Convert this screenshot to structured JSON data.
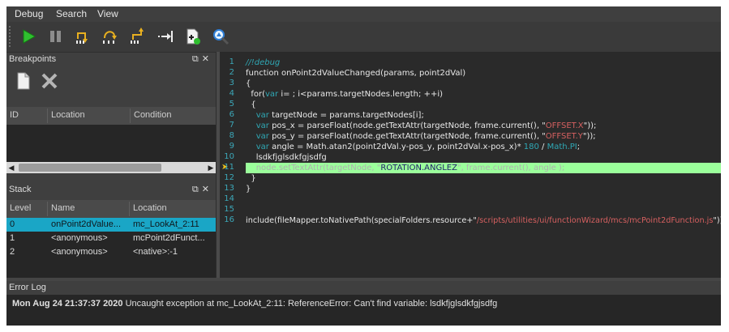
{
  "menu": [
    "Debug",
    "Search",
    "View"
  ],
  "toolbar": {
    "buttons": [
      "run-icon",
      "pause-icon",
      "step-into-icon",
      "step-over-icon",
      "step-out-icon",
      "run-to-cursor-icon",
      "add-watch-icon",
      "inspect-icon"
    ]
  },
  "breakpoints": {
    "title": "Breakpoints",
    "columns": [
      "ID",
      "Location",
      "Condition"
    ],
    "rows": []
  },
  "stack": {
    "title": "Stack",
    "columns": [
      "Level",
      "Name",
      "Location"
    ],
    "rows": [
      {
        "level": "0",
        "name": "onPoint2dValue...",
        "location": "mc_LookAt_2:11",
        "selected": true
      },
      {
        "level": "1",
        "name": "<anonymous>",
        "location": "mcPoint2dFunct...",
        "selected": false
      },
      {
        "level": "2",
        "name": "<anonymous>",
        "location": "<native>:-1",
        "selected": false
      }
    ]
  },
  "editor": {
    "line_numbers": [
      "1",
      "2",
      "3",
      "4",
      "5",
      "6",
      "7",
      "8",
      "9",
      "10",
      "11",
      "12",
      "13",
      "14",
      "15",
      "16"
    ],
    "current_line": 11,
    "lines": {
      "l1": "//!debug",
      "l2": "function onPoint2dValueChanged(params, point2dVal)",
      "l3": "{",
      "l4a": "  for(",
      "l4b": "var",
      "l4c": " i= ; i<params.targetNodes.length; ++i)",
      "l5": "  {",
      "l6a": "    ",
      "l6b": "var",
      "l6c": " targetNode = params.targetNodes[i];",
      "l7a": "    ",
      "l7b": "var",
      "l7c": " pos_x = parseFloat(node.getTextAttr(targetNode, frame.current(), \"",
      "l7d": "OFFSET.X",
      "l7e": "\"));",
      "l8a": "    ",
      "l8b": "var",
      "l8c": " pos_y = parseFloat(node.getTextAttr(targetNode, frame.current(), \"",
      "l8d": "OFFSET.Y",
      "l8e": "\"));",
      "l9a": "    ",
      "l9b": "var",
      "l9c": " angle = Math.atan2(point2dVal.y-pos_y, point2dVal.x-pos_x)* ",
      "l9d": "180",
      "l9e": " / ",
      "l9f": "Math.PI",
      "l9g": ";",
      "l10": "    lsdkfjglsdkfgjsdfg",
      "l11a": "    node.setTextAttr(targetNode, \"",
      "l11b": "ROTATION.ANGLEZ",
      "l11c": "\", frame.current(), angle );",
      "l12": "  }",
      "l13": "}",
      "l14": "",
      "l15": "",
      "l16a": "include(fileMapper.toNativePath(specialFolders.resource+\"",
      "l16b": "/scripts/utilities/ui/functionWizard/mcs/mcPoint2dFunction.js",
      "l16c": "\"))"
    }
  },
  "error_log": {
    "title": "Error Log",
    "timestamp": "Mon Aug 24 21:37:37 2020",
    "message": "Uncaught exception at mc_LookAt_2:11: ReferenceError: Can't find variable: lsdkfjglsdkfgjsdfg"
  },
  "colors": {
    "selection": "#1aa6c6",
    "current_line": "#9bff9b",
    "keyword": "#2fa8b5",
    "string": "#d66060"
  }
}
